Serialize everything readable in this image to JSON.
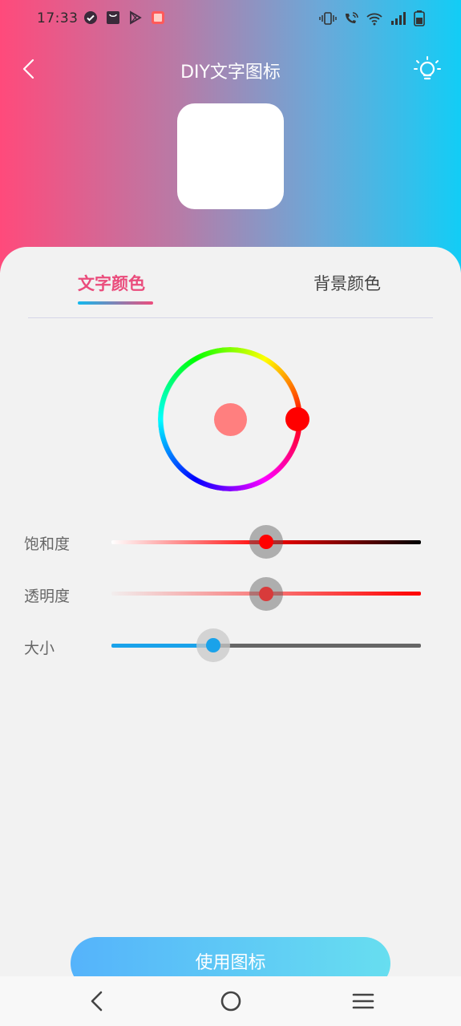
{
  "status_bar": {
    "time": "17:33",
    "left_icons": [
      "check-circle-icon",
      "shopping-bag-icon",
      "play-store-icon",
      "app-badge-icon"
    ],
    "right_icons": [
      "vibrate-icon",
      "wifi-calling-icon",
      "wifi-icon",
      "cell-signal-icon",
      "battery-icon"
    ]
  },
  "header": {
    "title": "DIY文字图标",
    "back_icon": "chevron-left-icon",
    "action_icon": "lightbulb-icon",
    "gradient": [
      "#ff4a7b",
      "#12cdf6"
    ]
  },
  "preview": {
    "background": "#ffffff"
  },
  "tabs": {
    "items": [
      {
        "label": "文字颜色",
        "active": true
      },
      {
        "label": "背景颜色",
        "active": false
      }
    ],
    "active_color": "#ea4c7c"
  },
  "color_wheel": {
    "hue_handle_color": "#ff0000",
    "preview_color": "#ff7f7f"
  },
  "sliders": [
    {
      "label": "饱和度",
      "value": 0.5,
      "thumb_color": "#ff0000"
    },
    {
      "label": "透明度",
      "value": 0.5,
      "thumb_color": "#d83b3b"
    },
    {
      "label": "大小",
      "value": 0.33,
      "thumb_color": "#1aa2ea"
    }
  ],
  "primary_button": {
    "label": "使用图标"
  },
  "nav_bar": {
    "icons": [
      "back-icon",
      "home-icon",
      "menu-icon"
    ]
  }
}
